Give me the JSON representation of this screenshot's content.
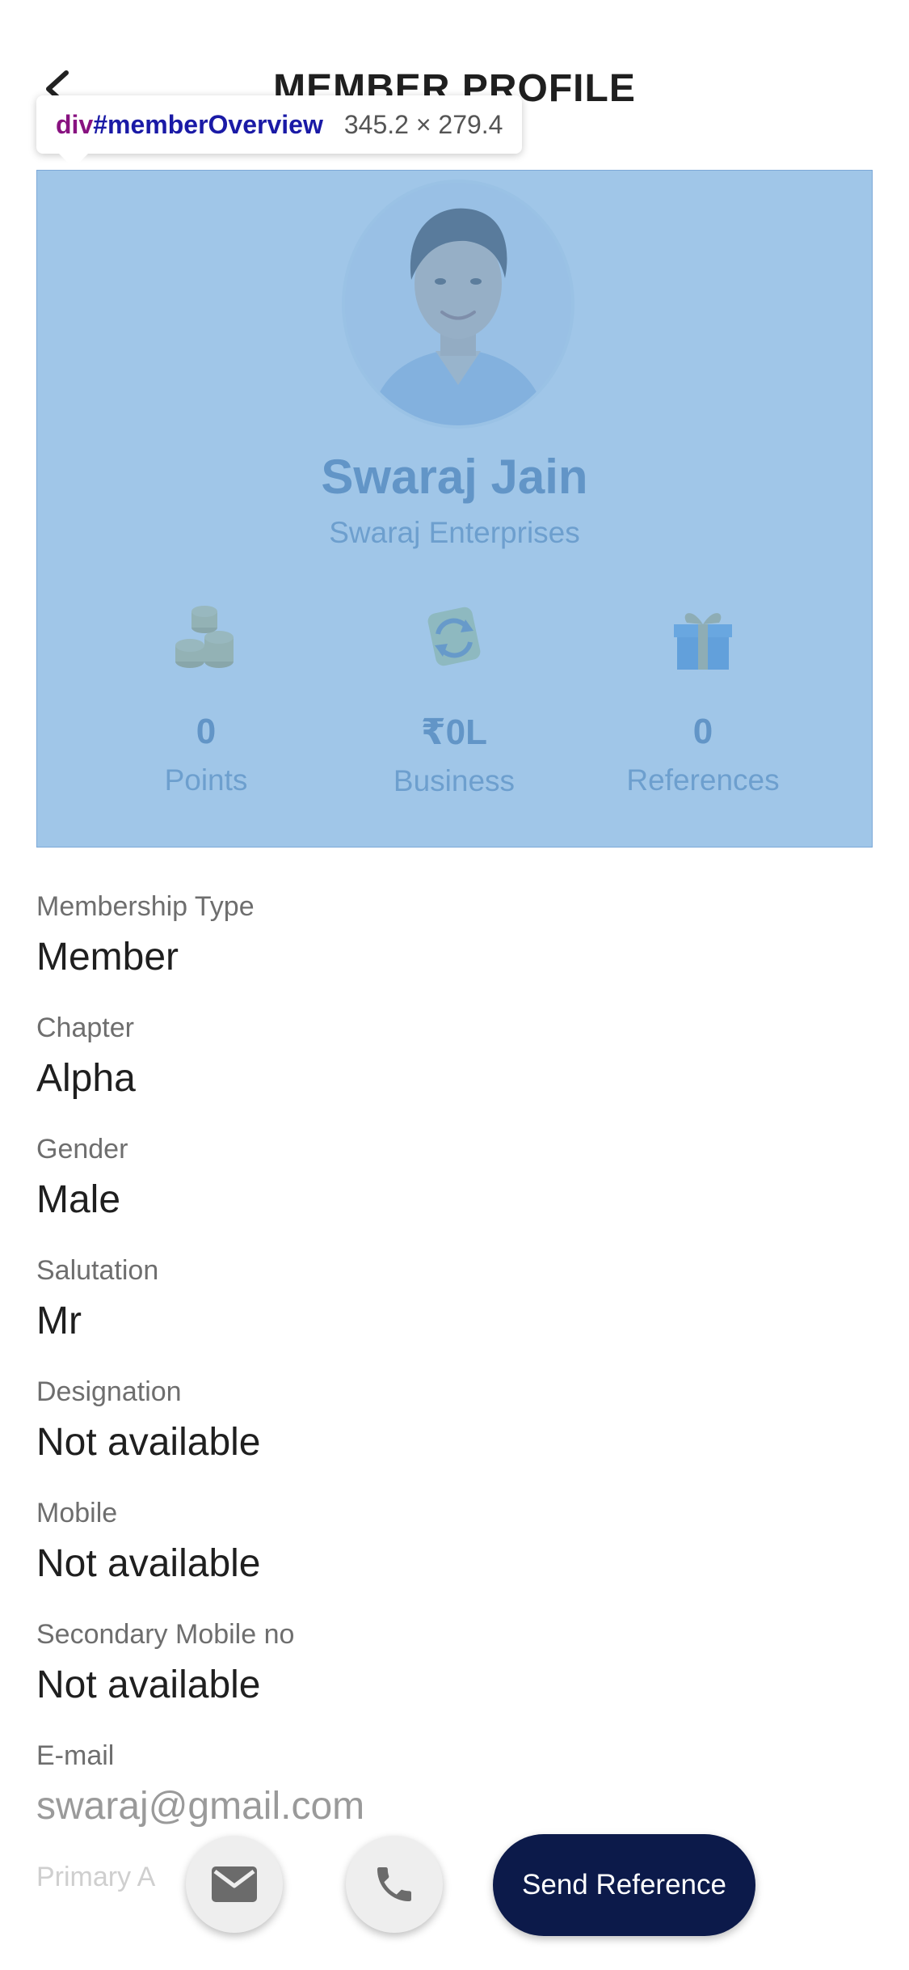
{
  "header": {
    "title": "MEMBER PROFILE"
  },
  "devtools": {
    "tag": "div",
    "id": "#memberOverview",
    "dims": "345.2 × 279.4"
  },
  "overview": {
    "name": "Swaraj Jain",
    "company": "Swaraj Enterprises",
    "stats": [
      {
        "value": "0",
        "label": "Points",
        "icon": "coins-icon"
      },
      {
        "value": "₹0L",
        "label": "Business",
        "icon": "exchange-icon"
      },
      {
        "value": "0",
        "label": "References",
        "icon": "gift-icon"
      }
    ]
  },
  "details": [
    {
      "label": "Membership Type",
      "value": "Member"
    },
    {
      "label": "Chapter",
      "value": "Alpha"
    },
    {
      "label": "Gender",
      "value": "Male"
    },
    {
      "label": "Salutation",
      "value": "Mr"
    },
    {
      "label": "Designation",
      "value": "Not available"
    },
    {
      "label": "Mobile",
      "value": "Not available"
    },
    {
      "label": "Secondary Mobile no",
      "value": "Not available"
    },
    {
      "label": "E-mail",
      "value": "swaraj@gmail.com"
    },
    {
      "label": "Primary A"
    }
  ],
  "actions": {
    "email_icon": "mail-icon",
    "call_icon": "phone-icon",
    "send_reference": "Send Reference"
  },
  "colors": {
    "highlight": "#6fa8dc",
    "primary_button": "#0c1a4a"
  }
}
